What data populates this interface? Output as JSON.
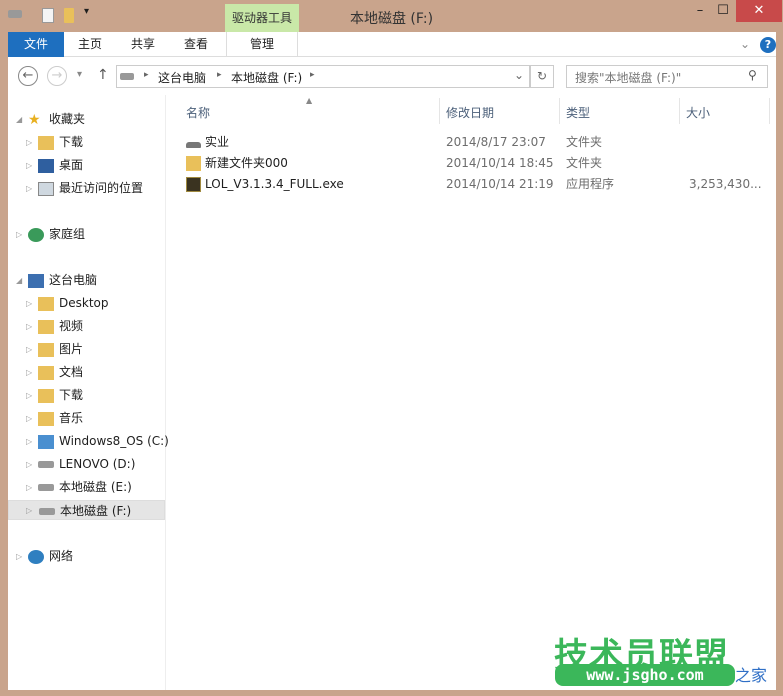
{
  "window": {
    "title": "本地磁盘 (F:)",
    "context_tab_group": "驱动器工具",
    "minimize": "–",
    "maximize": "☐",
    "close": "✕"
  },
  "ribbon": {
    "tabs": [
      {
        "label": "文件"
      },
      {
        "label": "主页"
      },
      {
        "label": "共享"
      },
      {
        "label": "查看"
      },
      {
        "label": "管理"
      }
    ],
    "expand": "⌄",
    "help": "?"
  },
  "nav": {
    "back": "←",
    "forward": "→",
    "recent": "▾",
    "up": "↑",
    "breadcrumb": [
      "这台电脑",
      "本地磁盘 (F:)"
    ],
    "sep": "▸",
    "dropdown": "⌄",
    "refresh": "↻",
    "search_placeholder": "搜索\"本地磁盘 (F:)\"",
    "search_icon": "⚲"
  },
  "sidebar": {
    "items": [
      {
        "label": "收藏夹",
        "icon": "star-icon"
      },
      {
        "label": "下载",
        "icon": "downloads-folder-icon"
      },
      {
        "label": "桌面",
        "icon": "desktop-icon"
      },
      {
        "label": "最近访问的位置",
        "icon": "recent-places-icon"
      },
      {
        "label": "家庭组",
        "icon": "homegroup-icon"
      },
      {
        "label": "这台电脑",
        "icon": "computer-icon"
      },
      {
        "label": "Desktop",
        "icon": "folder-icon"
      },
      {
        "label": "视频",
        "icon": "folder-icon"
      },
      {
        "label": "图片",
        "icon": "folder-icon"
      },
      {
        "label": "文档",
        "icon": "folder-icon"
      },
      {
        "label": "下载",
        "icon": "folder-icon"
      },
      {
        "label": "音乐",
        "icon": "folder-icon"
      },
      {
        "label": "Windows8_OS (C:)",
        "icon": "windows-drive-icon"
      },
      {
        "label": "LENOVO (D:)",
        "icon": "drive-icon"
      },
      {
        "label": "本地磁盘 (E:)",
        "icon": "drive-icon"
      },
      {
        "label": "本地磁盘 (F:)",
        "icon": "drive-icon",
        "selected": true
      },
      {
        "label": "网络",
        "icon": "network-icon"
      }
    ]
  },
  "columns": [
    "名称",
    "修改日期",
    "类型",
    "大小"
  ],
  "files": [
    {
      "name": "实业",
      "date": "2014/8/17 23:07",
      "type": "文件夹",
      "size": "",
      "icon": "drive-icon"
    },
    {
      "name": "新建文件夹000",
      "date": "2014/10/14 18:45",
      "type": "文件夹",
      "size": "",
      "icon": "folder-icon"
    },
    {
      "name": "LOL_V3.1.3.4_FULL.exe",
      "date": "2014/10/14 21:19",
      "type": "应用程序",
      "size": "3,253,430...",
      "icon": "exe-icon"
    }
  ],
  "watermark": {
    "title": "技术员联盟",
    "url": "www.jsgho.com",
    "suffix": "之家"
  },
  "colors": {
    "frame": "#c9a48c",
    "file_tab": "#1e6fbf",
    "context_tab": "#c9e8a8",
    "close": "#c84a4a"
  }
}
